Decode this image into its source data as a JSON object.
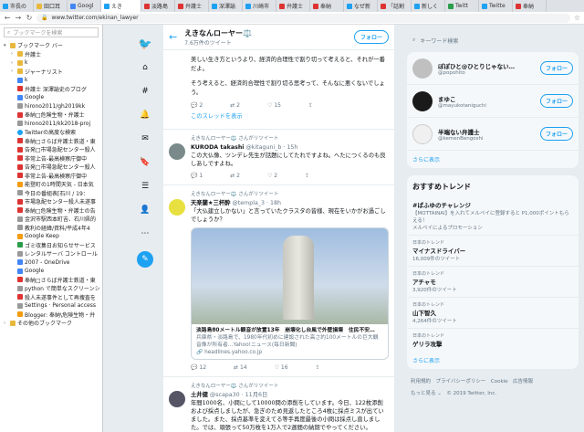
{
  "tabs": [
    {
      "label": "市長の",
      "color": "#1da1f2"
    },
    {
      "label": "田口耳",
      "color": "#e8b83d"
    },
    {
      "label": "Googl",
      "color": "#4285f4"
    },
    {
      "label": "えき",
      "color": "#1da1f2",
      "active": true
    },
    {
      "label": "淡路島",
      "color": "#d33"
    },
    {
      "label": "弁護士",
      "color": "#d33"
    },
    {
      "label": "深澤諭",
      "color": "#1da1f2"
    },
    {
      "label": "川崎市",
      "color": "#1da1f2"
    },
    {
      "label": "弁護士",
      "color": "#d33"
    },
    {
      "label": "奉納",
      "color": "#d33"
    },
    {
      "label": "なぜ新",
      "color": "#1da1f2"
    },
    {
      "label": "「話割",
      "color": "#d33"
    },
    {
      "label": "新しく",
      "color": "#1da1f2"
    },
    {
      "label": "Twitt",
      "color": "#2a9d4a"
    },
    {
      "label": "Twitte",
      "color": "#1da1f2"
    },
    {
      "label": "奉納",
      "color": "#d33"
    }
  ],
  "address": {
    "url": "www.twitter.com/ekinan_lawyer"
  },
  "sidebar": {
    "search_placeholder": "ブックマークを検索",
    "items": [
      {
        "label": "ブックマーク バー",
        "icon": "folder",
        "arrow": "▾"
      },
      {
        "label": "弁護士",
        "icon": "folder",
        "arrow": "›"
      },
      {
        "label": "k",
        "icon": "folder",
        "arrow": "›"
      },
      {
        "label": "ジャーナリスト",
        "icon": "folder",
        "arrow": "›"
      },
      {
        "label": "k",
        "icon": "g",
        "arrow": ""
      },
      {
        "label": "弁護士 深澤諭史のブログ",
        "icon": "red",
        "arrow": ""
      },
      {
        "label": "Google",
        "icon": "g",
        "arrow": ""
      },
      {
        "label": "hirono2011/gh2019kk",
        "icon": "gray",
        "arrow": ""
      },
      {
        "label": "奉納□危険生物・弁護士",
        "icon": "red",
        "arrow": ""
      },
      {
        "label": "hirono2011/kk2018-proj",
        "icon": "gray",
        "arrow": ""
      },
      {
        "label": "Twitterの高度な検索",
        "icon": "tw",
        "arrow": ""
      },
      {
        "label": "奉納□さらば弁護士鉄道・東",
        "icon": "red",
        "arrow": ""
      },
      {
        "label": "告発□市場急配センター殺人",
        "icon": "red",
        "arrow": ""
      },
      {
        "label": "非常上告-最高検察庁御中",
        "icon": "red",
        "arrow": ""
      },
      {
        "label": "告発□市場急配センター殺人",
        "icon": "red",
        "arrow": ""
      },
      {
        "label": "非常上告-最高検察庁御中",
        "icon": "red",
        "arrow": ""
      },
      {
        "label": "能登町の1時間天気 - 日本気",
        "icon": "orange",
        "arrow": ""
      },
      {
        "label": "今日の番組表[石川 / 19：",
        "icon": "gray",
        "arrow": ""
      },
      {
        "label": "市場急配センター殺人未遂事",
        "icon": "red",
        "arrow": ""
      },
      {
        "label": "奉納□危険生物・弁護士の告",
        "icon": "red",
        "arrow": ""
      },
      {
        "label": "金沢市駅西本町吉、石川県的",
        "icon": "gray",
        "arrow": ""
      },
      {
        "label": "教利の経緯/資料/平成4年4",
        "icon": "gray",
        "arrow": ""
      },
      {
        "label": "Google Keep",
        "icon": "orange",
        "arrow": ""
      },
      {
        "label": "ゴミ収集日お知らせサービス",
        "icon": "green",
        "arrow": ""
      },
      {
        "label": "レンタルサーバ コントロール",
        "icon": "gray",
        "arrow": ""
      },
      {
        "label": "2007 - OneDrive",
        "icon": "g",
        "arrow": ""
      },
      {
        "label": "Google",
        "icon": "g",
        "arrow": ""
      },
      {
        "label": "奉納□さらば弁護士鉄道・東",
        "icon": "red",
        "arrow": ""
      },
      {
        "label": "python で簡単なスクリーンシ",
        "icon": "gray",
        "arrow": ""
      },
      {
        "label": "殺人未遂事件として再捜査を",
        "icon": "red",
        "arrow": ""
      },
      {
        "label": "Settings · Personal access",
        "icon": "gray",
        "arrow": ""
      },
      {
        "label": "Blogger: 奉納\\危険生物・弁",
        "icon": "orange",
        "arrow": ""
      },
      {
        "label": "その他のブックマーク",
        "icon": "folder",
        "arrow": "›"
      }
    ]
  },
  "header": {
    "name": "えきなんローヤー⚖️",
    "count": "7.6万件のツイート",
    "follow": "フォロー"
  },
  "top_tweet": {
    "line1": "美しい生き方というより、経済的合理性で割り切って考えると、それが一番だよ。",
    "line2": "そう考えると、経済的合理性で割り切る思考って、そんなに悪くないでしょう。",
    "reply": "2",
    "retweet": "2",
    "like": "15",
    "thread": "このスレッドを表示"
  },
  "tweets": [
    {
      "rt": "えきなんローヤー⚖️ さんがリツイート",
      "name": "KURODA takashi",
      "handle": "@kitaguni_b · 15h",
      "text": "この大仏像、ツンデレ先生が話題にしてたれですよね。へたにつくるのも良しあしですよね。",
      "reply": "1",
      "retweet": "2",
      "like": "2",
      "avatar": "#7a8a8a"
    },
    {
      "rt": "えきなんローヤー⚖️ さんがリツイート",
      "name": "天楽蘭★三杯酔",
      "handle": "@templa_3 · 18h",
      "text": "「大仏建立しかない」と言っていたクラスタの皆様、現在をいかがお過ごしでしょうか？",
      "card_title": "淡路島80メートル観音が放置13年　崩壊化し台風で外壁損壊　住民不安…",
      "card_desc": "兵庫県・淡路島で、1980年代初めに建設された高さ約100メートルの巨大観音像が所有者…Yahoo!ニュース(毎日新聞)",
      "card_url": "headlines.yahoo.co.jp",
      "reply": "12",
      "retweet": "14",
      "like": "16",
      "avatar": "#e8e040"
    },
    {
      "rt": "えきなんローヤー⚖️ さんがリツイート",
      "name": "土井健",
      "handle": "@scapa30 · 11月6日",
      "text": "年間1000名、小問にして10000問の添削をしています。今日、122枚添削および採点しましたが、急ぎのため見返したところ4枚に採点ミスが出ていました。また、採点基準を変えてる等手再度最後の小問は採点し直しました。では、頑張って50万枚を1万人で2週間の納期でやってください。",
      "reply": "2",
      "retweet": "174",
      "like": "467",
      "avatar": "#556"
    }
  ],
  "right": {
    "search_placeholder": "キーワード検索",
    "users": [
      {
        "name": "ぽぽひと@ひとりじゃない…",
        "handle": "@popohito",
        "follow": "フォロー",
        "color": "#c0c0c0"
      },
      {
        "name": "まゆこ",
        "handle": "@mayukotaniguchi",
        "follow": "フォロー",
        "color": "#1a1a1a"
      },
      {
        "name": "半端ない弁護士",
        "handle": "@kemenBengoshi",
        "follow": "フォロー",
        "color": "#f0f0f0"
      }
    ],
    "more": "さらに表示",
    "trend_title": "おすすめトレンド",
    "trends": [
      {
        "cat": "",
        "name": "#ぱふゆのチャレンジ",
        "count": "",
        "desc": "【MOTTAINAI】を入れてメルペイに登録すると P1,000ポイントもらえる！"
      },
      {
        "cat": "日本のトレンド",
        "name": "マイナスドライバー",
        "count": "16,009件のツイート",
        "desc": ""
      },
      {
        "cat": "日本のトレンド",
        "name": "アチャモ",
        "count": "3,920件のツイート",
        "desc": ""
      },
      {
        "cat": "日本のトレンド",
        "name": "山下智久",
        "count": "4,264件のツイート",
        "desc": ""
      },
      {
        "cat": "日本のトレンド",
        "name": "ゲリラ攻撃",
        "count": "",
        "desc": ""
      }
    ],
    "promo": "メルペイによるプロモーション",
    "trend_more": "さらに表示",
    "footer1": "利用規約　プライバシーポリシー　Cookie　広告情報",
    "footer2": "もっと見る ⌄　© 2019 Twitter, Inc."
  }
}
